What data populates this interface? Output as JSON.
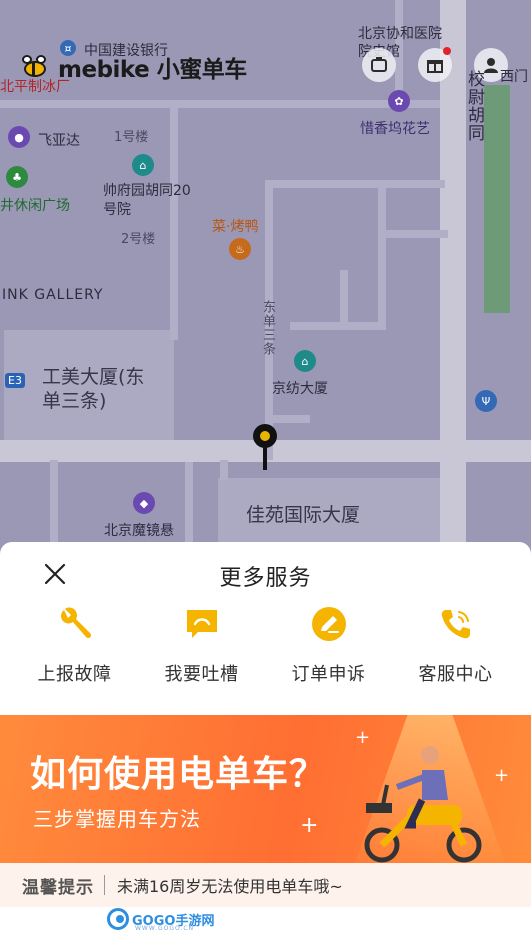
{
  "app": {
    "brand": "mebike 小蜜单车"
  },
  "map": {
    "labels": {
      "bank": "中国建设银行",
      "hospital": "北京协和医院院史馆",
      "ice_factory": "北平制冰厂",
      "feiyada": "飞亚达",
      "building1": "1号楼",
      "hutong20": "帅府园胡同20号院",
      "building2": "2号楼",
      "leisure_square": "井休闲广场",
      "restaurant": "菜·烤鸭",
      "flower_shop": "惜香坞花艺",
      "gallery": "INK GALLERY",
      "gongmei": "工美大厦(东单三条)",
      "dongdan": "东单三条",
      "jingfang": "京纺大厦",
      "jiayuan": "佳苑国际大厦",
      "mojing": "北京魔镜悬",
      "xiaowei": "校尉胡同",
      "ximen": "西门",
      "e3": "E3"
    },
    "icons": {
      "bank": "bank-icon",
      "hospital": "hospital-icon",
      "poi": "poi-icon",
      "gift": "gift-icon",
      "user": "user-icon",
      "scan": "scan-icon"
    }
  },
  "sheet": {
    "title": "更多服务",
    "services": [
      {
        "label": "上报故障",
        "icon": "wrench-icon"
      },
      {
        "label": "我要吐槽",
        "icon": "comment-icon"
      },
      {
        "label": "订单申诉",
        "icon": "edit-icon"
      },
      {
        "label": "客服中心",
        "icon": "phone-icon"
      }
    ],
    "banner": {
      "title": "如何使用电单车？",
      "subtitle": "三步掌握用车方法"
    },
    "tip": {
      "label": "温馨提示",
      "text": "未满16周岁无法使用电单车哦~"
    },
    "watermark": "GOGO手游网",
    "watermark_domain": "WWW.GOGO.CN"
  },
  "colors": {
    "accent": "#F5B400",
    "banner": "#FF7A35",
    "map_bg": "#9B98B6"
  }
}
